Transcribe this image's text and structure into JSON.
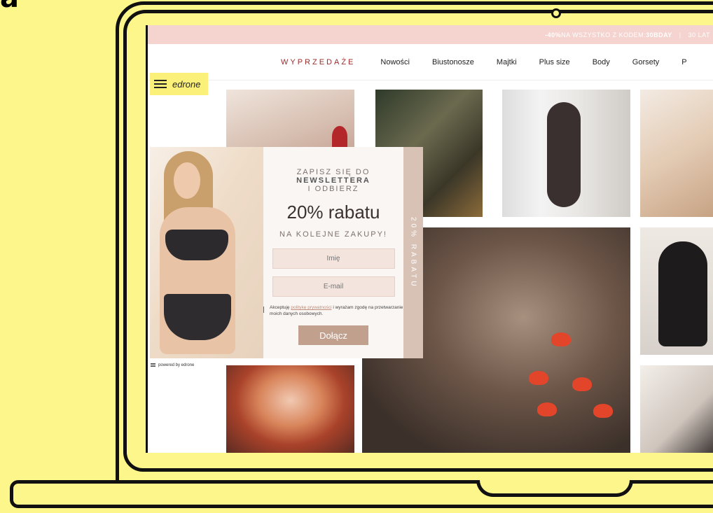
{
  "corner_text": "a",
  "promo": {
    "text_before": "-40%",
    "text_middle": " NA WSZYSTKO Z KODEM: ",
    "code": "30BDAY",
    "separator": "|",
    "text_after": "30 LAT"
  },
  "nav": {
    "sale": "WYPRZEDAŻE",
    "items": [
      "Nowości",
      "Biustonosze",
      "Majtki",
      "Plus size",
      "Body",
      "Gorsety",
      "P"
    ]
  },
  "edrone": {
    "label": "edrone",
    "powered_by": "powered by edrone"
  },
  "popup": {
    "title_line1_prefix": "ZAPISZ SIĘ DO ",
    "title_line1_bold": "NEWSLETTERA",
    "title_line2": "I ODBIERZ",
    "discount": "20% rabatu",
    "subtitle": "NA KOLEJNE ZAKUPY!",
    "name_placeholder": "Imię",
    "email_placeholder": "E-mail",
    "consent_prefix": "Akceptuję ",
    "consent_link": "politykę prywatności",
    "consent_suffix": " i wyrażam zgodę na przetwarzanie moich danych osobowych.",
    "join_label": "Dołącz",
    "side_strip": "20% RABATU"
  },
  "colors": {
    "background": "#fdf68a",
    "promo_bar": "#f5d3cf",
    "sale_link": "#9b2a2a",
    "join_button": "#c2a08e"
  }
}
